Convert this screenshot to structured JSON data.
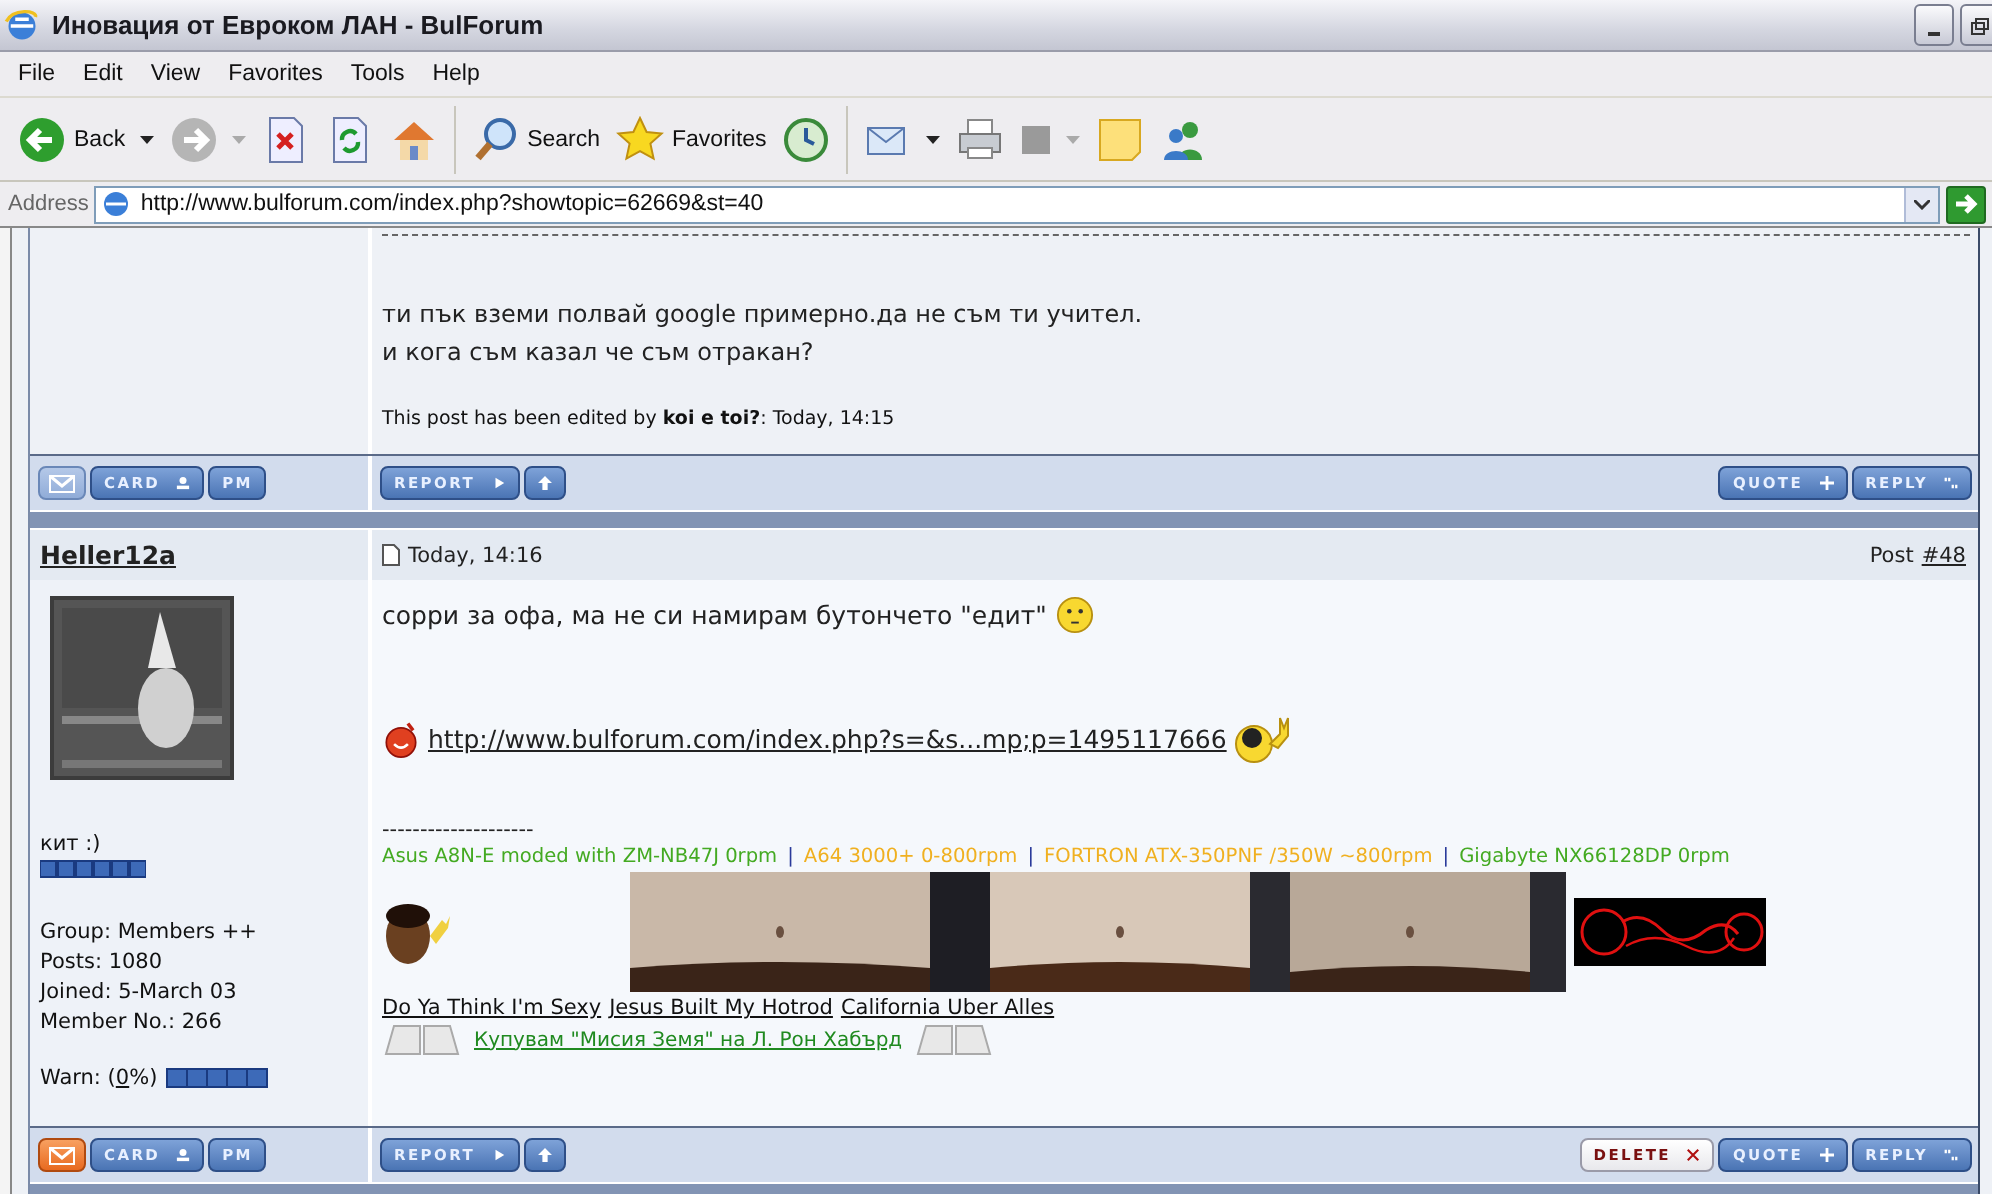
{
  "window": {
    "title": "Иновация от Евроком ЛАН - BulForum"
  },
  "menu": [
    "File",
    "Edit",
    "View",
    "Favorites",
    "Tools",
    "Help"
  ],
  "toolbar": [
    {
      "kind": "back",
      "label": "Back"
    },
    {
      "kind": "forward"
    },
    {
      "kind": "stop"
    },
    {
      "kind": "refresh"
    },
    {
      "kind": "home"
    },
    {
      "kind": "search",
      "label": "Search"
    },
    {
      "kind": "favorites",
      "label": "Favorites"
    },
    {
      "kind": "history"
    },
    {
      "kind": "mail"
    },
    {
      "kind": "print"
    },
    {
      "kind": "square"
    },
    {
      "kind": "note"
    },
    {
      "kind": "messenger"
    }
  ],
  "address": {
    "label": "Address",
    "value": "http://www.bulforum.com/index.php?showtopic=62669&st=40"
  },
  "posts": [
    {
      "body": [
        "ти пък вземи полвай google примерно.да не съм ти учител.",
        "и кога съм казал че съм отракан?"
      ],
      "edited": "This post has been edited by **koi e toi?**: Today, 14:15",
      "left_buttons": [
        {
          "kind": "email",
          "highlight": false
        },
        {
          "kind": "card",
          "label": "CARD"
        },
        {
          "kind": "pm",
          "label": "PM"
        }
      ],
      "mid_buttons": [
        {
          "kind": "report",
          "label": "REPORT"
        },
        {
          "kind": "top"
        }
      ],
      "right_buttons": [
        {
          "kind": "quote",
          "label": "QUOTE"
        },
        {
          "kind": "reply",
          "label": "REPLY"
        }
      ]
    },
    {
      "author": "Heller12a",
      "date": "Today, 14:16",
      "post_label": "Post",
      "post_number": "#48",
      "profile": {
        "title": "кит :)",
        "info": [
          "Group: Members ++",
          "Posts: 1080",
          "Joined: 5-March 03",
          "Member No.: 266"
        ],
        "warn": {
          "prefix": "Warn: (",
          "value": "0",
          "suffix": "%)"
        }
      },
      "text": "сорри за офа, ма не си намирам бутончето \"едит\"",
      "link": "http://www.bulforum.com/index.php?s=&s...mp;p=1495117666",
      "sig_rule": "--------------------",
      "specs": [
        {
          "text": "Asus A8N-E moded with ZM-NB47J 0rpm",
          "color": "#44aa22"
        },
        {
          "text": "|",
          "color": "#2a3a9a"
        },
        {
          "text": "A64 3000+ 0-800rpm",
          "color": "#f0b020"
        },
        {
          "text": "|",
          "color": "#2a3a9a"
        },
        {
          "text": "FORTRON ATX-350PNF /350W ~800rpm",
          "color": "#f0b020"
        },
        {
          "text": "|",
          "color": "#2a3a9a"
        },
        {
          "text": "Gigabyte NX66128DP 0rpm",
          "color": "#44aa22"
        }
      ],
      "songs": [
        "Do Ya Think I'm Sexy",
        "Jesus Built My Hotrod",
        "California Uber Alles"
      ],
      "book": "Купувам \"Мисия Земя\" на Л. Рон Хабърд",
      "left_buttons": [
        {
          "kind": "email",
          "highlight": true
        },
        {
          "kind": "card",
          "label": "CARD"
        },
        {
          "kind": "pm",
          "label": "PM"
        }
      ],
      "mid_buttons": [
        {
          "kind": "report",
          "label": "REPORT"
        },
        {
          "kind": "top"
        }
      ],
      "right_buttons": [
        {
          "kind": "delete",
          "label": "DELETE"
        },
        {
          "kind": "quote",
          "label": "QUOTE"
        },
        {
          "kind": "reply",
          "label": "REPLY"
        }
      ]
    }
  ]
}
